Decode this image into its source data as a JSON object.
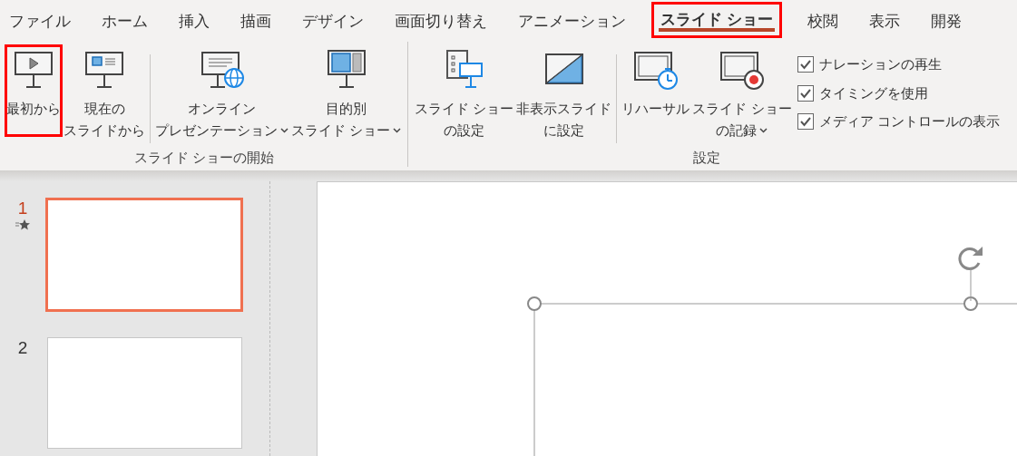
{
  "tabs": [
    {
      "label": "ファイル",
      "selected": false,
      "highlighted": false
    },
    {
      "label": "ホーム",
      "selected": false,
      "highlighted": false
    },
    {
      "label": "挿入",
      "selected": false,
      "highlighted": false
    },
    {
      "label": "描画",
      "selected": false,
      "highlighted": false
    },
    {
      "label": "デザイン",
      "selected": false,
      "highlighted": false
    },
    {
      "label": "画面切り替え",
      "selected": false,
      "highlighted": false
    },
    {
      "label": "アニメーション",
      "selected": false,
      "highlighted": false
    },
    {
      "label": "スライド ショー",
      "selected": true,
      "highlighted": true
    },
    {
      "label": "校閲",
      "selected": false,
      "highlighted": false
    },
    {
      "label": "表示",
      "selected": false,
      "highlighted": false
    },
    {
      "label": "開発",
      "selected": false,
      "highlighted": false
    }
  ],
  "ribbon": {
    "groups": [
      {
        "label": "スライド ショーの開始",
        "items": [
          {
            "kind": "button",
            "lines": [
              "最初から"
            ],
            "dropdown": false,
            "highlighted": true
          },
          {
            "kind": "button",
            "lines": [
              "現在の",
              "スライドから"
            ],
            "dropdown": false,
            "highlighted": false
          },
          {
            "kind": "separator"
          },
          {
            "kind": "button",
            "lines": [
              "オンライン",
              "プレゼンテーション"
            ],
            "dropdown": true,
            "highlighted": false
          },
          {
            "kind": "button",
            "lines": [
              "目的別",
              "スライド ショー"
            ],
            "dropdown": true,
            "highlighted": false
          }
        ]
      },
      {
        "label": "設定",
        "items": [
          {
            "kind": "button",
            "lines": [
              "スライド ショー",
              "の設定"
            ],
            "dropdown": false,
            "highlighted": false
          },
          {
            "kind": "button",
            "lines": [
              "非表示スライド",
              "に設定"
            ],
            "dropdown": false,
            "highlighted": false
          },
          {
            "kind": "separator"
          },
          {
            "kind": "button",
            "lines": [
              "リハーサル"
            ],
            "dropdown": false,
            "highlighted": false
          },
          {
            "kind": "button",
            "lines": [
              "スライド ショー",
              "の記録"
            ],
            "dropdown": true,
            "highlighted": false
          },
          {
            "kind": "checkboxes",
            "items": [
              {
                "label": "ナレーションの再生",
                "checked": true
              },
              {
                "label": "タイミングを使用",
                "checked": true
              },
              {
                "label": "メディア コントロールの表示",
                "checked": true
              }
            ]
          }
        ]
      }
    ]
  },
  "slides": [
    {
      "number": "1",
      "selected": true,
      "animated": true
    },
    {
      "number": "2",
      "selected": false,
      "animated": false
    }
  ]
}
